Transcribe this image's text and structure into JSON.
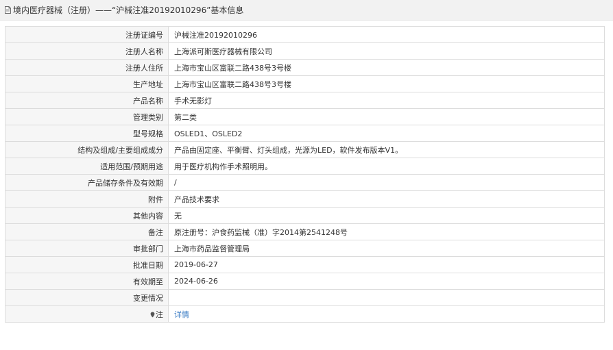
{
  "header": {
    "title": "境内医疗器械（注册）——“沪械注准20192010296”基本信息",
    "icon": "document-icon"
  },
  "rows": [
    {
      "label": "注册证编号",
      "value": "沪械注准20192010296"
    },
    {
      "label": "注册人名称",
      "value": "上海派可斯医疗器械有限公司"
    },
    {
      "label": "注册人住所",
      "value": "上海市宝山区富联二路438号3号楼"
    },
    {
      "label": "生产地址",
      "value": "上海市宝山区富联二路438号3号楼"
    },
    {
      "label": "产品名称",
      "value": "手术无影灯"
    },
    {
      "label": "管理类别",
      "value": "第二类"
    },
    {
      "label": "型号规格",
      "value": "OSLED1、OSLED2"
    },
    {
      "label": "结构及组成/主要组成成分",
      "value": "产品由固定座、平衡臂、灯头组成，光源为LED，软件发布版本V1。"
    },
    {
      "label": "适用范围/预期用途",
      "value": "用于医疗机构作手术照明用。"
    },
    {
      "label": "产品储存条件及有效期",
      "value": "/"
    },
    {
      "label": "附件",
      "value": "产品技术要求"
    },
    {
      "label": "其他内容",
      "value": "无"
    },
    {
      "label": "备注",
      "value": "原注册号：沪食药监械（准）字2014第2541248号"
    },
    {
      "label": "审批部门",
      "value": "上海市药品监督管理局"
    },
    {
      "label": "批准日期",
      "value": "2019-06-27"
    },
    {
      "label": "有效期至",
      "value": "2024-06-26"
    },
    {
      "label": "变更情况",
      "value": ""
    }
  ],
  "note_row": {
    "label": "注",
    "icon": "map-pin-icon",
    "link_text": "详情"
  },
  "colors": {
    "link": "#3a7cc4",
    "label_bg": "#f6f6f6",
    "border": "#dcdcdc",
    "header_bg": "#f2f2f2"
  }
}
